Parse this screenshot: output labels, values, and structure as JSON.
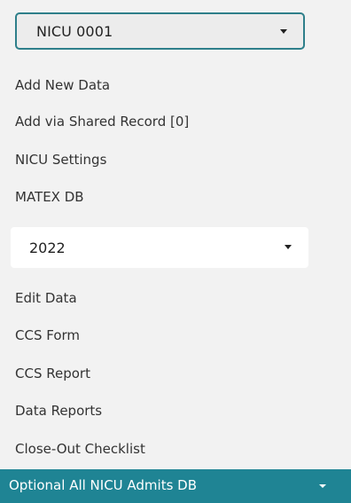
{
  "nicu_select": {
    "value": "NICU 0001"
  },
  "menu_top": [
    {
      "name": "add-new-data-link",
      "label": "Add New Data"
    },
    {
      "name": "add-via-shared-record-link",
      "label": "Add via Shared Record [0]"
    },
    {
      "name": "nicu-settings-link",
      "label": "NICU Settings"
    },
    {
      "name": "matex-db-link",
      "label": "MATEX DB"
    }
  ],
  "year_select": {
    "value": "2022"
  },
  "menu_bottom": [
    {
      "name": "edit-data-link",
      "label": "Edit Data"
    },
    {
      "name": "ccs-form-link",
      "label": "CCS Form"
    },
    {
      "name": "ccs-report-link",
      "label": "CCS Report"
    },
    {
      "name": "data-reports-link",
      "label": "Data Reports"
    },
    {
      "name": "close-out-checklist-link",
      "label": "Close-Out Checklist"
    }
  ],
  "footer": {
    "label": "Optional All NICU Admits DB"
  },
  "colors": {
    "accent": "#1f8494",
    "select_border": "#2e7f8a",
    "panel_bg": "#f2f2f2"
  }
}
